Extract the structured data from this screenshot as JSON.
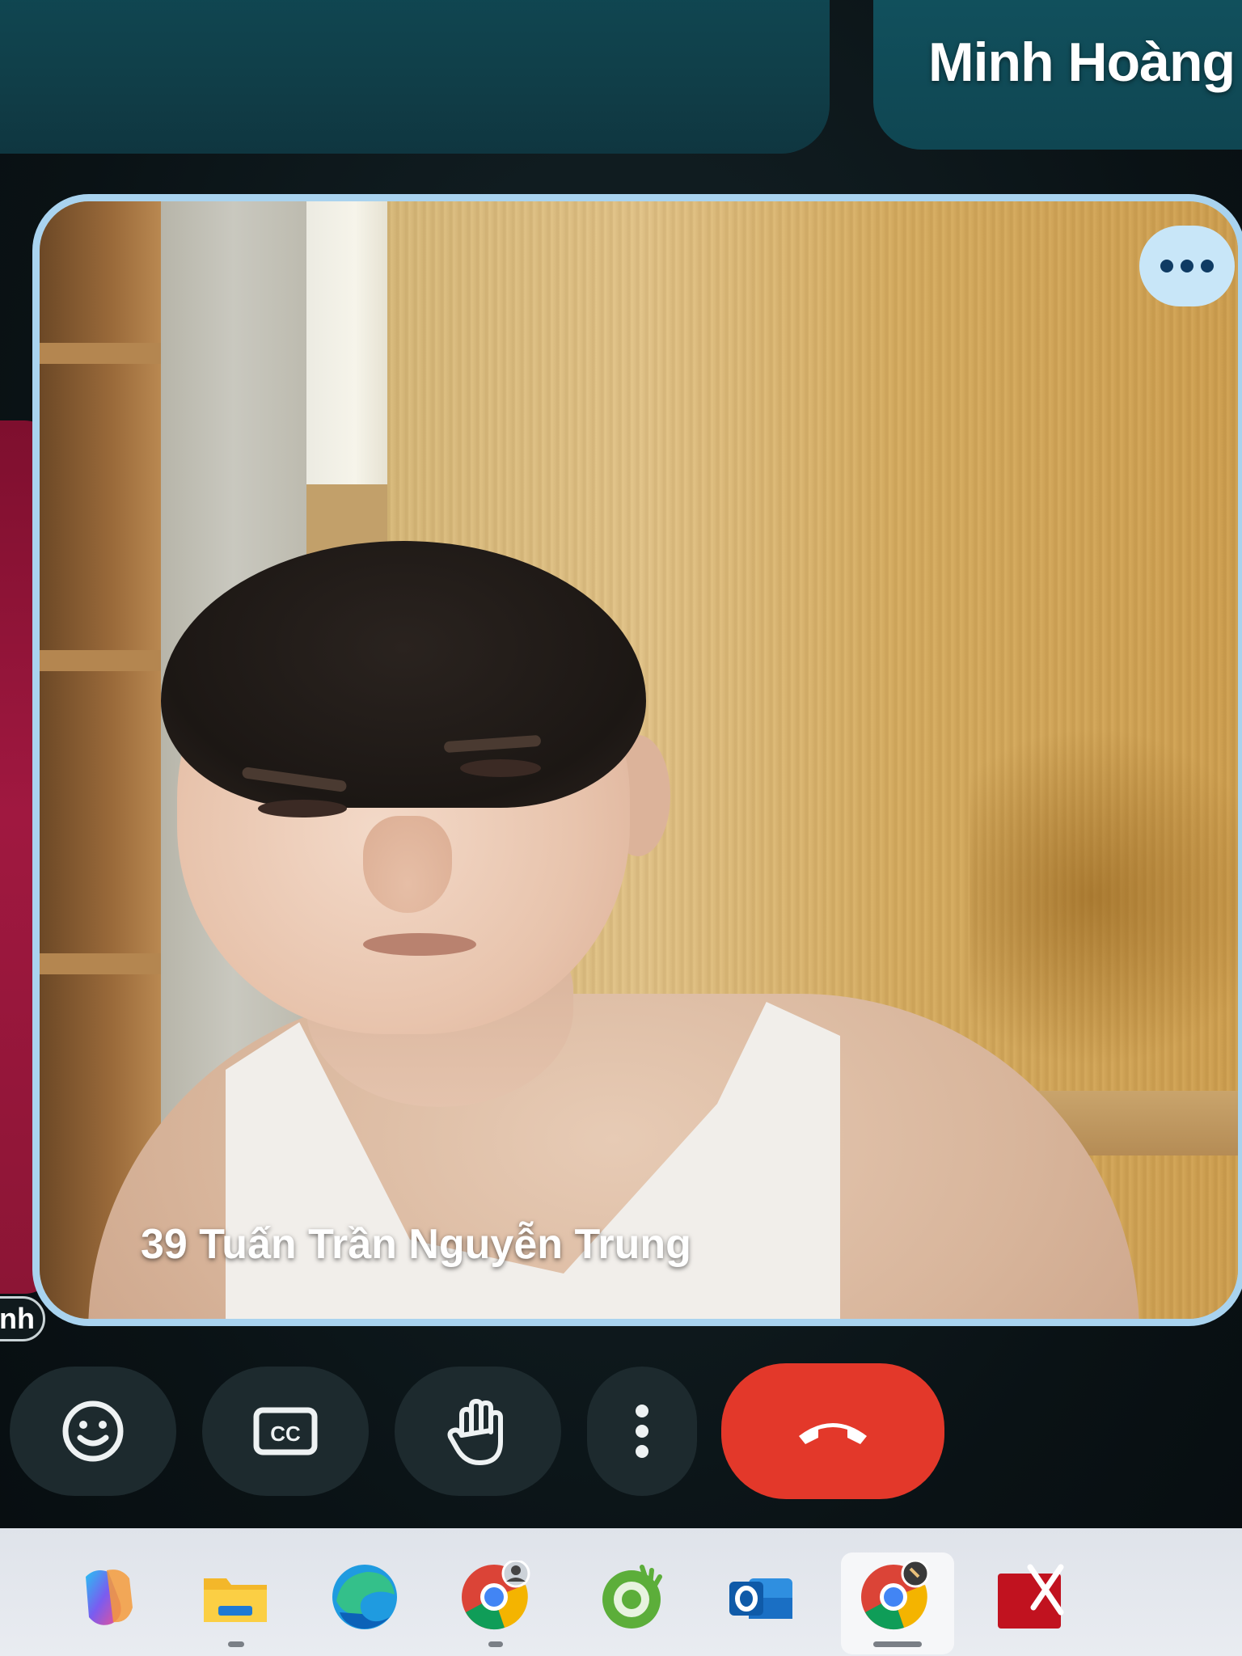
{
  "top_tiles": {
    "right_participant_name": "Minh Hoàng"
  },
  "left_tile": {
    "label_fragment": "nh"
  },
  "main_tile": {
    "participant_name": "39 Tuấn Trần Nguyễn Trung",
    "more_options_icon": "more-horizontal-icon",
    "border_color": "#a9d3ef"
  },
  "controls": [
    {
      "name": "emoji-reaction-button",
      "icon": "smiley-icon"
    },
    {
      "name": "captions-button",
      "icon": "closed-captions-icon"
    },
    {
      "name": "raise-hand-button",
      "icon": "hand-icon"
    },
    {
      "name": "more-options-button",
      "icon": "more-vertical-icon"
    },
    {
      "name": "leave-call-button",
      "icon": "phone-hangup-icon",
      "color": "#e3382a"
    }
  ],
  "taskbar": {
    "apps": [
      {
        "name": "copilot",
        "icon": "copilot-icon"
      },
      {
        "name": "file-explorer",
        "icon": "folder-icon"
      },
      {
        "name": "edge",
        "icon": "edge-icon"
      },
      {
        "name": "chrome-profile",
        "icon": "chrome-icon"
      },
      {
        "name": "coc-coc",
        "icon": "coccoc-icon"
      },
      {
        "name": "outlook",
        "icon": "outlook-icon"
      },
      {
        "name": "chrome-active",
        "icon": "chrome-icon"
      },
      {
        "name": "pdf-xchange",
        "icon": "pdf-icon"
      }
    ]
  }
}
